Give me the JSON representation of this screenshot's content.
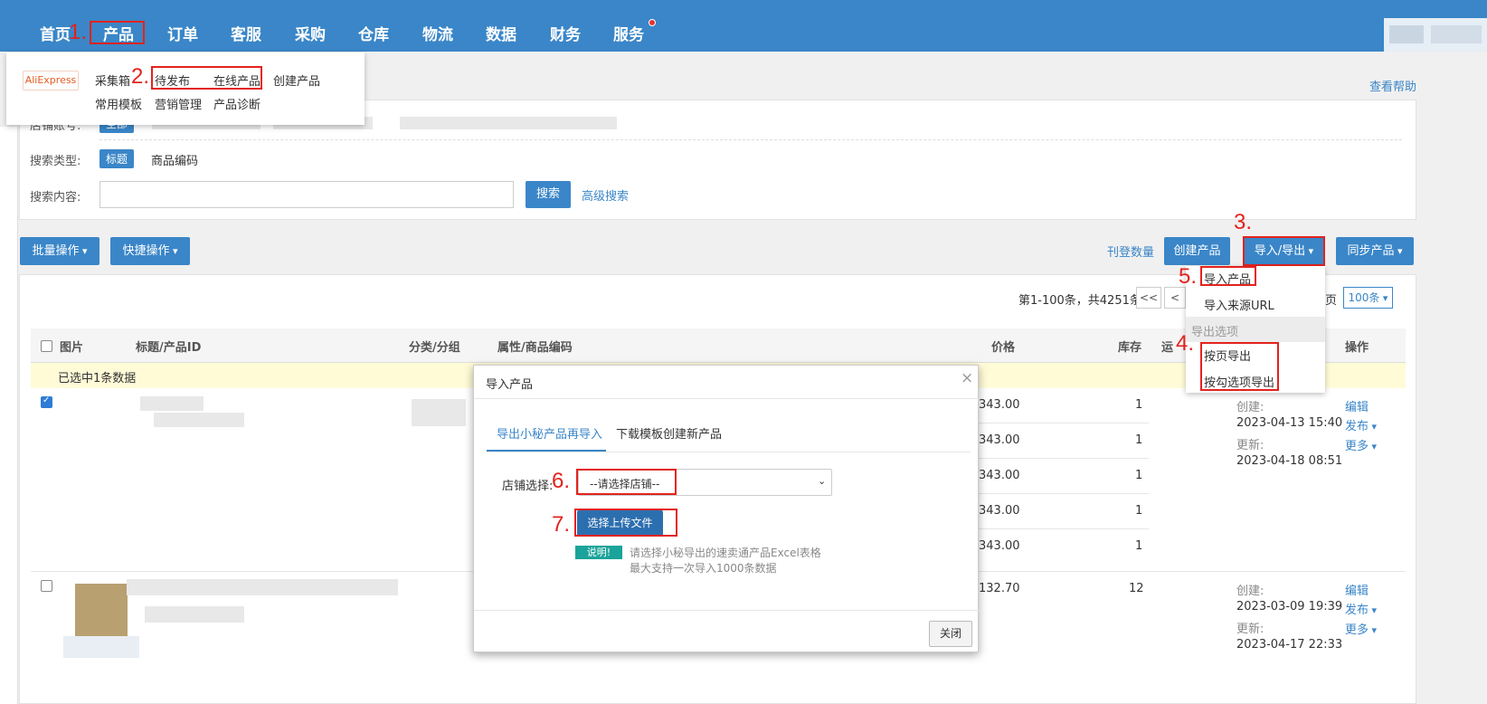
{
  "nav": {
    "items": [
      "首页",
      "产品",
      "订单",
      "客服",
      "采购",
      "仓库",
      "物流",
      "数据",
      "财务",
      "服务"
    ],
    "help_link": "查看帮助"
  },
  "annotations": [
    "1.",
    "2.",
    "3.",
    "4.",
    "5.",
    "6.",
    "7."
  ],
  "product_menu": {
    "brand": "AliExpress",
    "row1": [
      "采集箱",
      "待发布",
      "在线产品",
      "创建产品"
    ],
    "row2": [
      "常用模板",
      "营销管理",
      "产品诊断"
    ]
  },
  "search": {
    "store_label": "店铺账号:",
    "store_all": "全部",
    "type_label": "搜索类型:",
    "type_title": "标题",
    "type_sku": "商品编码",
    "content_label": "搜索内容:",
    "input_value": "",
    "search_button": "搜索",
    "advanced_link": "高级搜索"
  },
  "toolbar": {
    "batch": "批量操作",
    "quick": "快捷操作",
    "listing_count": "刊登数量",
    "create": "创建产品",
    "import_export": "导入/导出",
    "sync": "同步产品"
  },
  "import_export_menu": {
    "import_product": "导入产品",
    "import_url": "导入来源URL",
    "export_header": "导出选项",
    "export_page": "按页导出",
    "export_checked": "按勾选项导出"
  },
  "pagination": {
    "summary": "第1-100条，共4251条",
    "first": "<<",
    "prev": "<",
    "page_suffix": "页",
    "page_size": "100条"
  },
  "table": {
    "headers": [
      "图片",
      "标题/产品ID",
      "分类/分组",
      "属性/商品编码",
      "价格",
      "库存",
      "运",
      "操作"
    ],
    "selected_notice": "已选中1条数据",
    "rows": [
      {
        "checked": true,
        "prices": [
          "343.00",
          "343.00",
          "343.00",
          "343.00",
          "343.00"
        ],
        "stocks": [
          "1",
          "1",
          "1",
          "1",
          "1"
        ],
        "created_label": "创建:",
        "created": "2023-04-13 15:40",
        "updated_label": "更新:",
        "updated": "2023-04-18 08:51",
        "actions": [
          "编辑",
          "发布",
          "更多"
        ]
      },
      {
        "checked": false,
        "prices": [
          "132.70"
        ],
        "stocks": [
          "12"
        ],
        "created_label": "创建:",
        "created": "2023-03-09 19:39",
        "updated_label": "更新:",
        "updated": "2023-04-17 22:33",
        "actions": [
          "编辑",
          "发布",
          "更多"
        ]
      }
    ]
  },
  "modal": {
    "title": "导入产品",
    "close_x": "×",
    "tab_active": "导出小秘产品再导入",
    "tab_other": "下载模板创建新产品",
    "store_label": "店铺选择:",
    "store_placeholder": "--请选择店铺--",
    "upload_button": "选择上传文件",
    "note_badge": "说明!",
    "note_line1": "请选择小秘导出的速卖通产品Excel表格",
    "note_line2": "最大支持一次导入1000条数据",
    "close_button": "关闭"
  },
  "colors": {
    "primary": "#3a86c8",
    "annotation_red": "#e3221d",
    "selected_bg": "#fffbd7",
    "note_badge": "#1aa39a"
  }
}
